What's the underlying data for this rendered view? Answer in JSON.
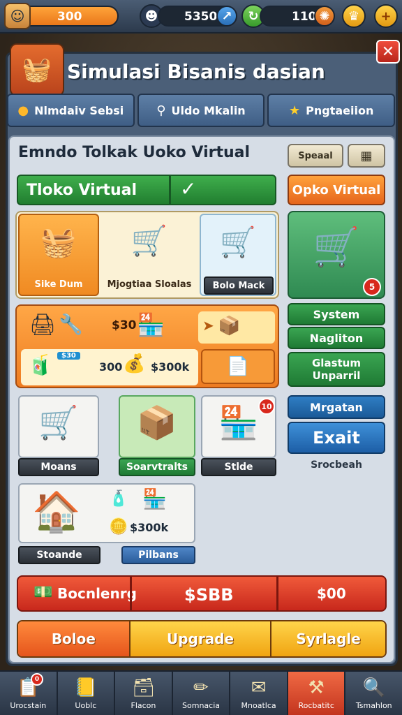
{
  "top_bar": {
    "coins": "300",
    "gems": "5350",
    "energy": "110"
  },
  "header": {
    "title": "Simulasi Bisanis dasian",
    "close": "✕"
  },
  "tabs": [
    {
      "label": "Nlmdaiv Sebsi",
      "icon": "location-pin-icon"
    },
    {
      "label": "Uldo Mkalin",
      "icon": "search-icon"
    },
    {
      "label": "Pngtaeiion",
      "icon": "star-icon"
    }
  ],
  "store": {
    "title": "Emndo Tolkak Uoko Virtual",
    "special_btn": "Speaal",
    "status_label": "Tloko Virtual",
    "check": "✓",
    "open_btn": "Opko Virtual"
  },
  "shop_items": [
    {
      "label": "Sike Dum",
      "icon": "basket-icon"
    },
    {
      "label": "Mjogtiaa Sloalas",
      "icon": "cart-icon"
    },
    {
      "label": "Bolo Mack",
      "icon": "cart-icon"
    }
  ],
  "side_panel": {
    "badge": "5",
    "buttons": [
      "System",
      "Nagliton",
      "Glastum Unparril",
      "Mrgatan",
      "Exait"
    ],
    "footer": "Srocbeah"
  },
  "orange_panel": {
    "row1_value": "$30",
    "row2_tag": "$30",
    "row2_value": "300",
    "row2_amount": "$300k"
  },
  "cards": [
    {
      "label": "Moans",
      "icon": "cart-icon"
    },
    {
      "label": "Soarvtralts",
      "icon": "crate-icon"
    },
    {
      "label": "Stlde",
      "icon": "market-stall-icon",
      "badge": "10"
    }
  ],
  "store_card": {
    "label": "Stoande",
    "button": "Pilbans",
    "amount": "$300k"
  },
  "summary": {
    "left": "Bocnlenrg",
    "middle": "$SBB",
    "right": "$00"
  },
  "actions": [
    "Boloe",
    "Upgrade",
    "Syrlagle"
  ],
  "nav": [
    {
      "label": "Urocstain",
      "icon": "clipboard-icon",
      "badge": "0"
    },
    {
      "label": "Uoblc",
      "icon": "book-icon"
    },
    {
      "label": "Flacon",
      "icon": "box-icon"
    },
    {
      "label": "Somnacia",
      "icon": "pencil-icon"
    },
    {
      "label": "Mnoatlca",
      "icon": "envelope-icon"
    },
    {
      "label": "Rocbatitc",
      "icon": "tools-icon",
      "active": true
    },
    {
      "label": "Tsmahlon",
      "icon": "magnifier-icon"
    }
  ],
  "colors": {
    "panel": "#4b5f78",
    "accent_orange": "#ee7c21",
    "accent_green": "#2f8a52",
    "accent_red": "#c8281c"
  }
}
